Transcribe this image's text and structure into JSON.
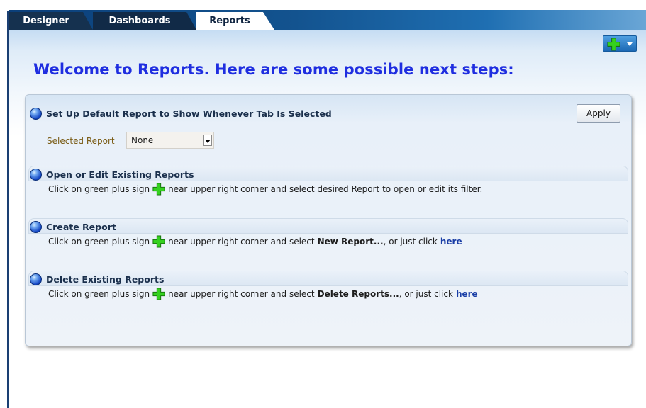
{
  "tabs": [
    {
      "label": "Designer",
      "active": false
    },
    {
      "label": "Dashboards",
      "active": false
    },
    {
      "label": "Reports",
      "active": true
    }
  ],
  "toolbar": {
    "add_icon": "green-plus-icon",
    "menu_icon": "chevron-down-icon"
  },
  "welcome_text": "Welcome to Reports.  Here are some possible next steps:",
  "sections": {
    "default_report": {
      "title": "Set Up Default Report to Show Whenever Tab Is Selected",
      "apply_label": "Apply",
      "selected_report_label": "Selected Report",
      "selected_report_value": "None"
    },
    "open_edit": {
      "title": "Open or Edit Existing Reports",
      "desc_before": "Click on green plus sign",
      "desc_after": "near upper right corner and select desired Report to open or edit its filter."
    },
    "create": {
      "title": "Create Report",
      "desc_before": "Click on green plus sign",
      "desc_mid": "near upper right corner and select",
      "desc_bold": "New Report...",
      "desc_tail": ", or just click",
      "link": "here"
    },
    "delete": {
      "title": "Delete Existing Reports",
      "desc_before": "Click on green plus sign",
      "desc_mid": "near upper right corner and select",
      "desc_bold": "Delete Reports...",
      "desc_tail": ", or just click",
      "link": "here"
    }
  },
  "colors": {
    "accent_blue": "#1f2ee0",
    "tab_bar_dark": "#0b3f7a",
    "plus_green": "#2ecc1a",
    "link_blue": "#1a3ea6"
  }
}
